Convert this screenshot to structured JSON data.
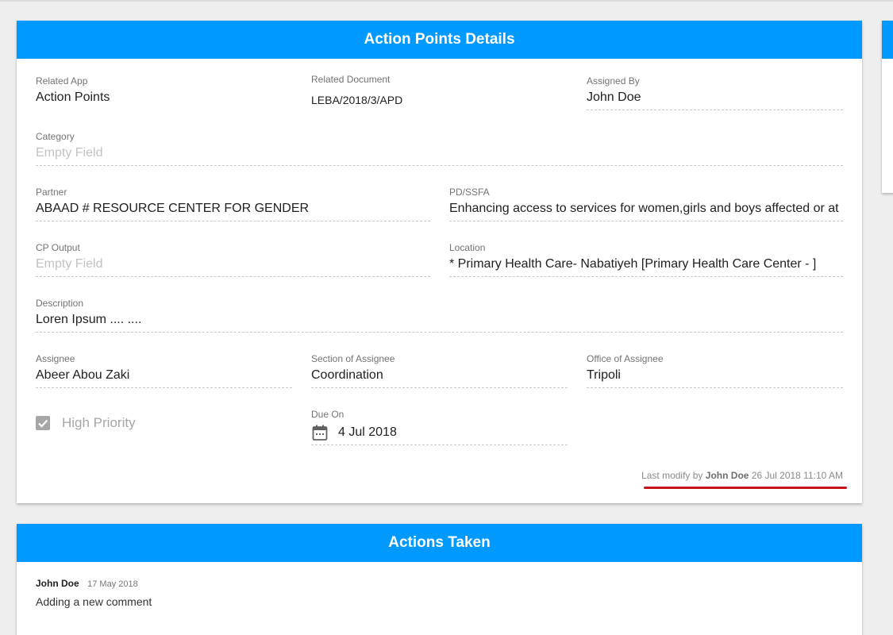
{
  "details": {
    "title": "Action Points Details",
    "related_app": {
      "label": "Related App",
      "value": "Action Points"
    },
    "related_document": {
      "label": "Related Document",
      "value": "LEBA/2018/3/APD"
    },
    "assigned_by": {
      "label": "Assigned By",
      "value": "John Doe"
    },
    "category": {
      "label": "Category",
      "placeholder": "Empty Field"
    },
    "partner": {
      "label": "Partner",
      "value": "ABAAD # RESOURCE CENTER FOR GENDER"
    },
    "pd_ssfa": {
      "label": "PD/SSFA",
      "value": "Enhancing access to services for women,girls and boys affected or at"
    },
    "cp_output": {
      "label": "CP Output",
      "placeholder": "Empty Field"
    },
    "location": {
      "label": "Location",
      "value": "* Primary Health Care- Nabatiyeh [Primary Health Care Center - ]"
    },
    "description": {
      "label": "Description",
      "value": "Loren Ipsum .... ...."
    },
    "assignee": {
      "label": "Assignee",
      "value": "Abeer Abou Zaki"
    },
    "section": {
      "label": "Section of Assignee",
      "value": "Coordination"
    },
    "office": {
      "label": "Office of Assignee",
      "value": "Tripoli"
    },
    "high_priority": {
      "label": "High Priority",
      "checked": true
    },
    "due_on": {
      "label": "Due On",
      "value": "4 Jul 2018",
      "icon": "calendar-icon"
    },
    "last_modify": {
      "prefix": "Last modify by",
      "user": "John Doe",
      "timestamp": "26 Jul 2018 11:10 AM"
    }
  },
  "actions_taken": {
    "title": "Actions Taken",
    "comments": [
      {
        "author": "John Doe",
        "date": "17 May 2018",
        "text": "Adding a new comment"
      }
    ]
  },
  "colors": {
    "header_blue": "#0099ff",
    "annotation_red": "#c8121b",
    "checkbox_gray": "#a6a6a6"
  }
}
